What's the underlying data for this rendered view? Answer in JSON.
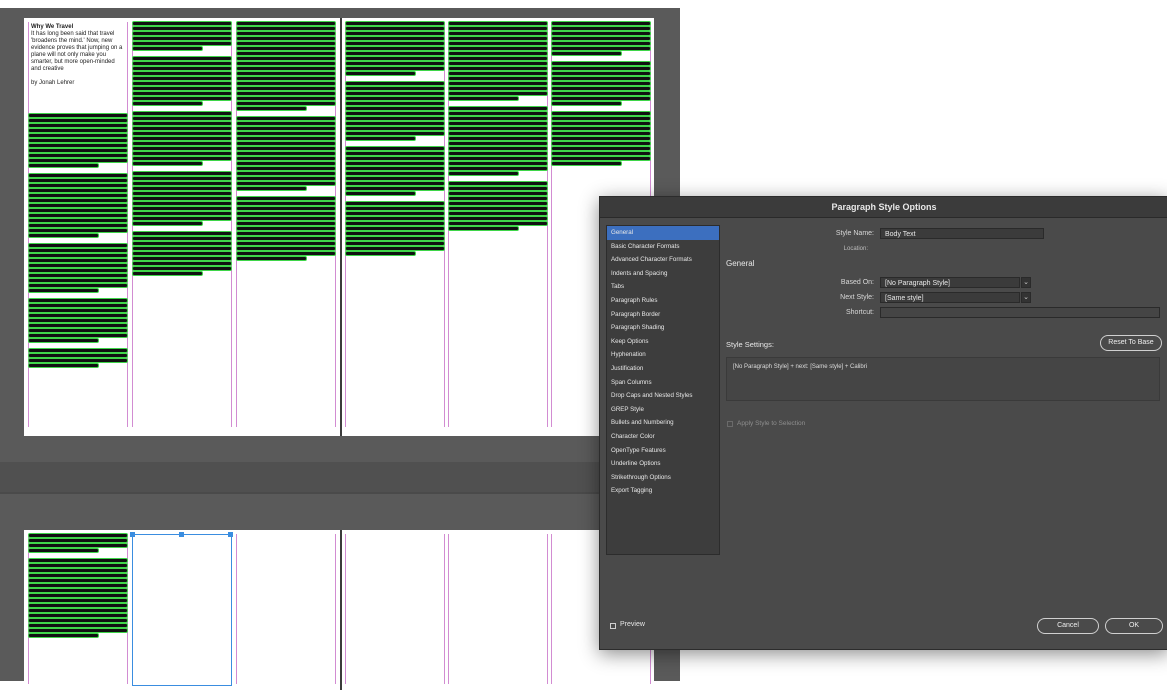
{
  "layout_doc": {
    "article": {
      "heading": "Why We Travel",
      "intro": "It has long been said that travel 'broadens the mind.' Now, new evidence proves that jumping on a plane will not only make you smarter, but more open-minded and creative",
      "byline": "by Jonah Lehrer"
    }
  },
  "dialog": {
    "title": "Paragraph Style Options",
    "categories": [
      "General",
      "Basic Character Formats",
      "Advanced Character Formats",
      "Indents and Spacing",
      "Tabs",
      "Paragraph Rules",
      "Paragraph Border",
      "Paragraph Shading",
      "Keep Options",
      "Hyphenation",
      "Justification",
      "Span Columns",
      "Drop Caps and Nested Styles",
      "GREP Style",
      "Bullets and Numbering",
      "Character Color",
      "OpenType Features",
      "Underline Options",
      "Strikethrough Options",
      "Export Tagging"
    ],
    "selected_category": "General",
    "style_name_label": "Style Name:",
    "style_name_value": "Body Text",
    "location_label": "Location:",
    "section_general": "General",
    "based_on_label": "Based On:",
    "based_on_value": "[No Paragraph Style]",
    "next_style_label": "Next Style:",
    "next_style_value": "[Same style]",
    "shortcut_label": "Shortcut:",
    "shortcut_value": "",
    "style_settings_label": "Style Settings:",
    "reset_button": "Reset To Base",
    "style_settings_text": "[No Paragraph Style] + next: [Same style] + Calibri",
    "apply_label": "Apply Style to Selection",
    "preview_label": "Preview",
    "cancel_button": "Cancel",
    "ok_button": "OK",
    "colors": {
      "panel": "#4a4a4a",
      "selection": "#3c6fbf"
    }
  }
}
